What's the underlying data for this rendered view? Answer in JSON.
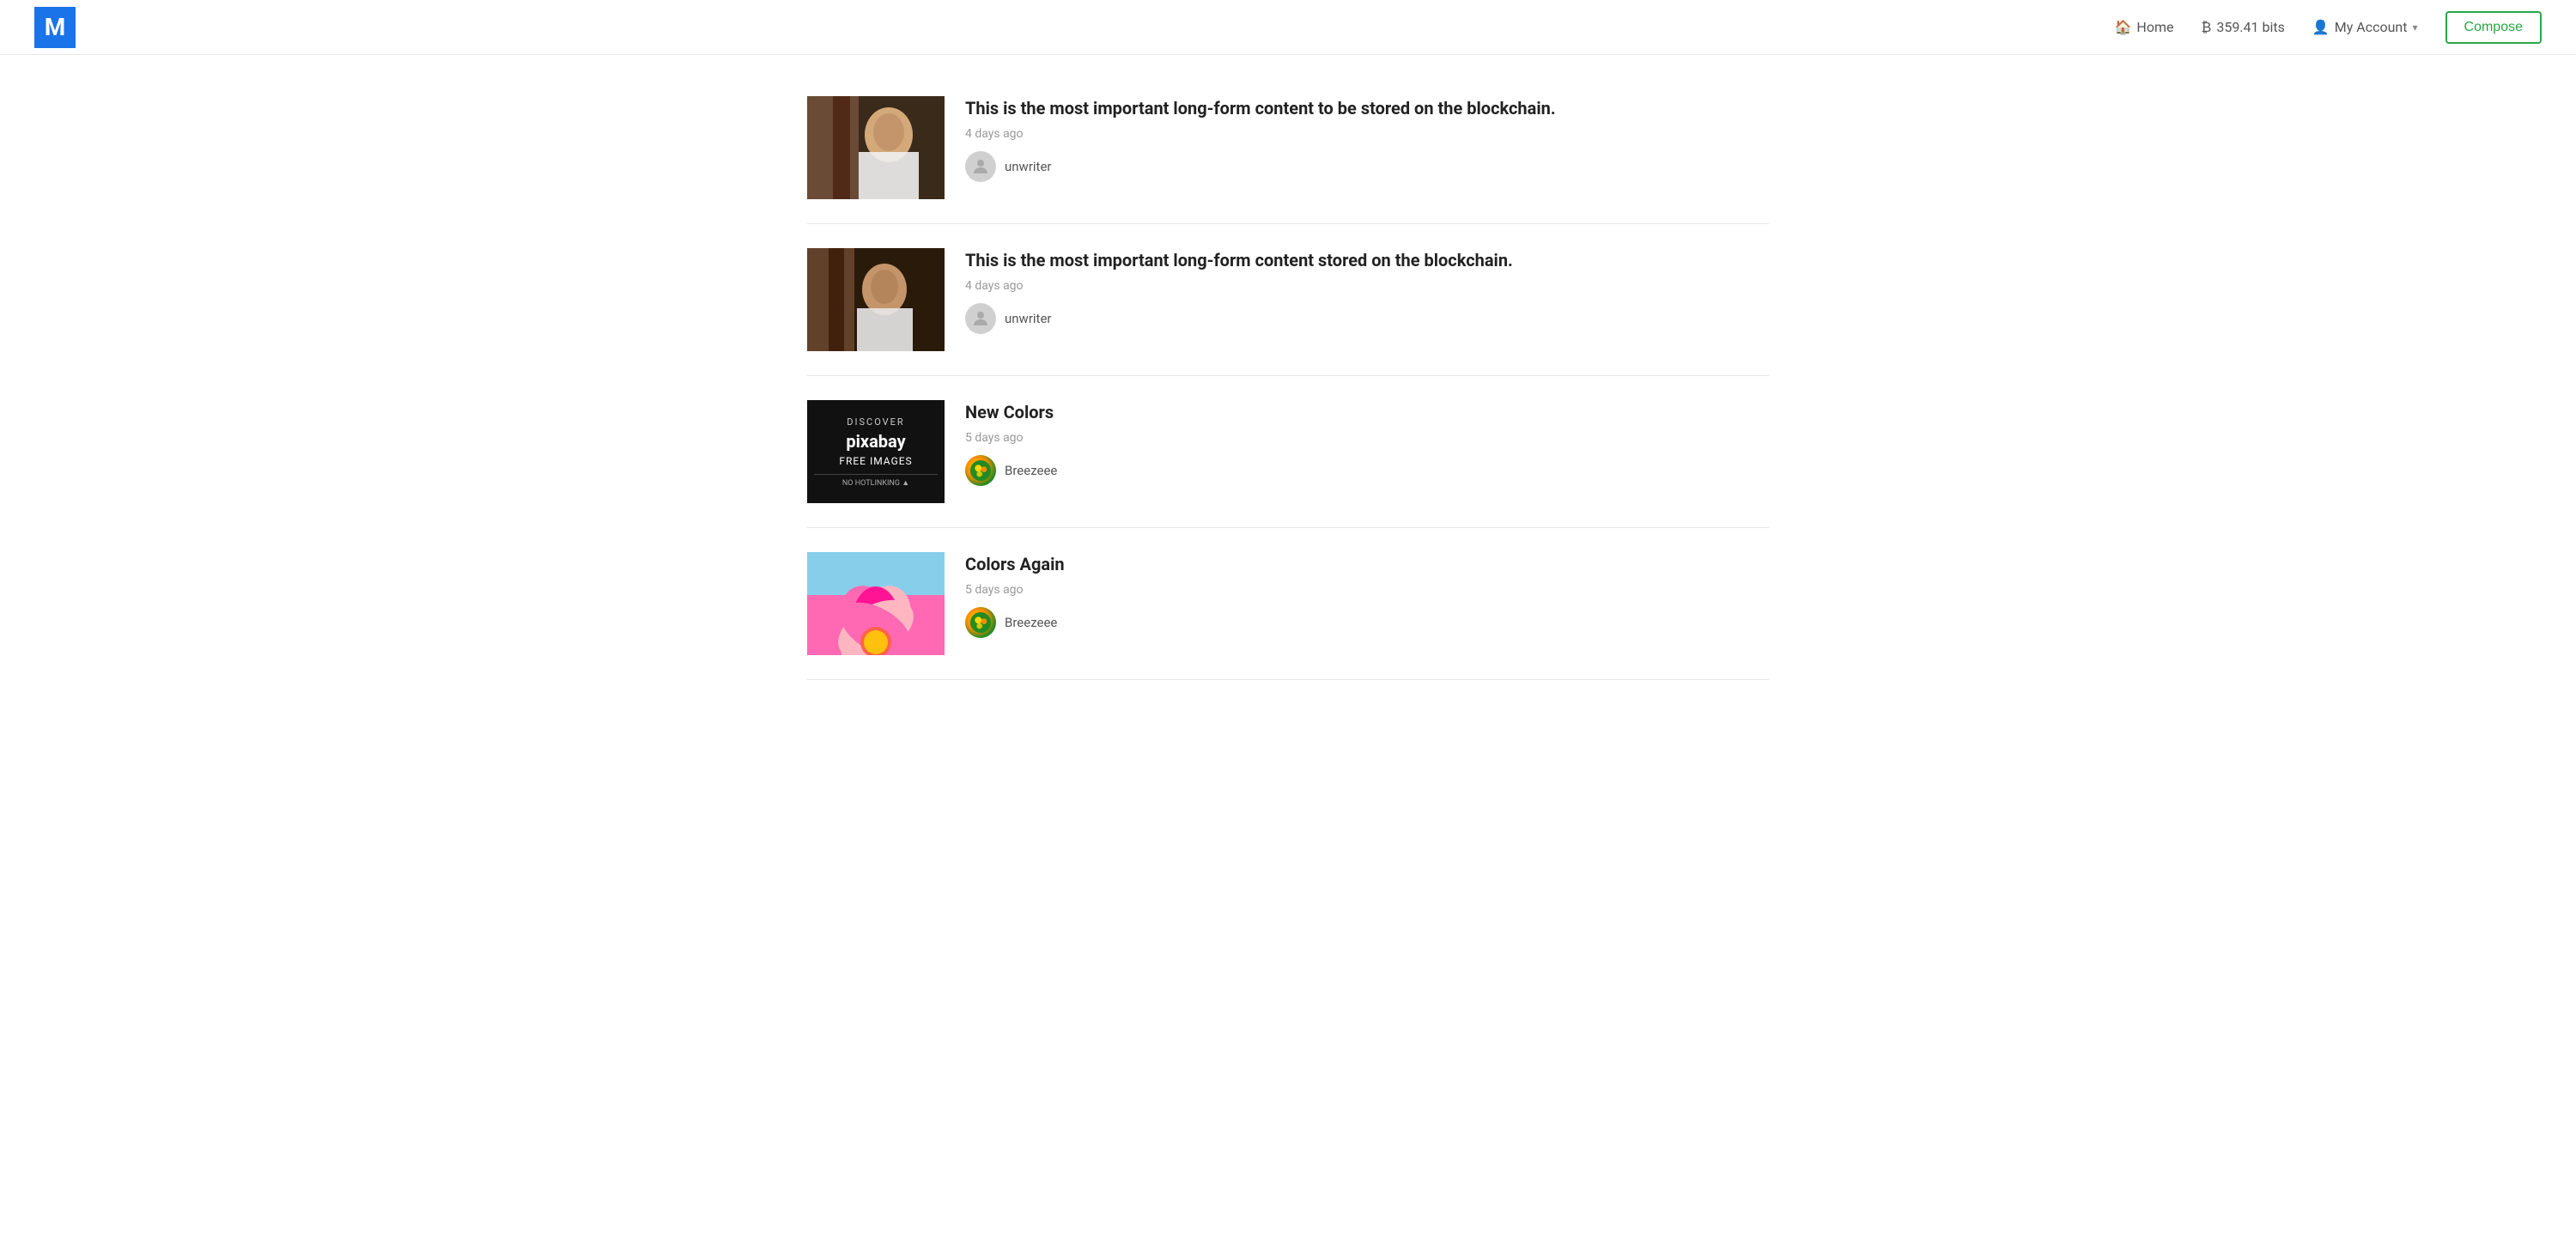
{
  "header": {
    "logo_letter": "M",
    "nav_home": "Home",
    "nav_bits": "359.41 bits",
    "nav_account": "My Account",
    "compose_label": "Compose"
  },
  "articles": [
    {
      "id": "article-1",
      "title": "This is the most important long-form content to be stored on the blockchain.",
      "timestamp": "4 days ago",
      "author": "unwriter",
      "author_avatar_type": "default",
      "thumbnail_type": "person1"
    },
    {
      "id": "article-2",
      "title": "This is the most important long-form content stored on the blockchain.",
      "timestamp": "4 days ago",
      "author": "unwriter",
      "author_avatar_type": "default",
      "thumbnail_type": "person2"
    },
    {
      "id": "article-3",
      "title": "New Colors",
      "timestamp": "5 days ago",
      "author": "Breezeee",
      "author_avatar_type": "breezeee",
      "thumbnail_type": "pixabay"
    },
    {
      "id": "article-4",
      "title": "Colors Again",
      "timestamp": "5 days ago",
      "author": "Breezeee",
      "author_avatar_type": "breezeee",
      "thumbnail_type": "flower"
    }
  ]
}
